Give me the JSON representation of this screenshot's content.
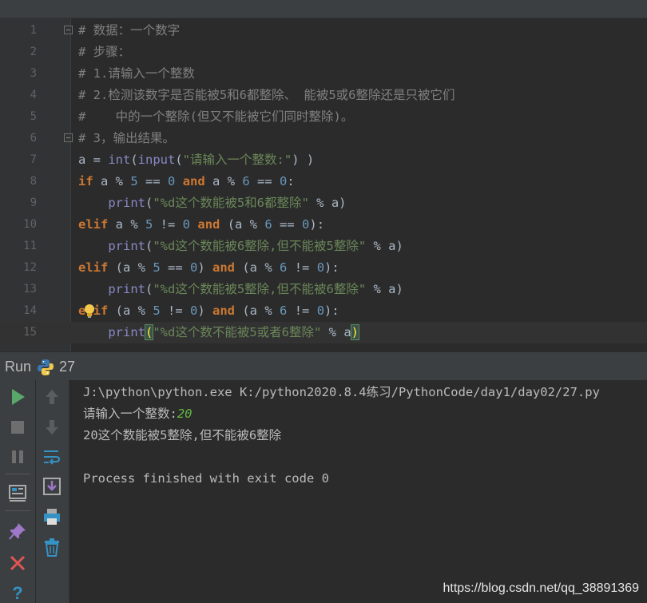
{
  "editor": {
    "lines": [
      {
        "num": "1",
        "parts": [
          {
            "c": "c",
            "t": "# 数据：一个数字"
          }
        ]
      },
      {
        "num": "2",
        "parts": [
          {
            "c": "c",
            "t": "# 步骤："
          }
        ]
      },
      {
        "num": "3",
        "parts": [
          {
            "c": "c",
            "t": "# 1.请输入一个整数"
          }
        ]
      },
      {
        "num": "4",
        "parts": [
          {
            "c": "c",
            "t": "# 2.检测该数字是否能被5和6都整除、 能被5或6整除还是只被它们"
          }
        ]
      },
      {
        "num": "5",
        "parts": [
          {
            "c": "c",
            "t": "#    中的一个整除(但又不能被它们同时整除)。"
          }
        ]
      },
      {
        "num": "6",
        "parts": [
          {
            "c": "c",
            "t": "# 3，输出结果。"
          }
        ]
      },
      {
        "num": "7",
        "parts": [
          {
            "c": "t",
            "t": "a = "
          },
          {
            "c": "b",
            "t": "int"
          },
          {
            "c": "t",
            "t": "("
          },
          {
            "c": "b",
            "t": "input"
          },
          {
            "c": "t",
            "t": "("
          },
          {
            "c": "s",
            "t": "\"请输入一个整数:\""
          },
          {
            "c": "t",
            "t": ") )"
          }
        ]
      },
      {
        "num": "8",
        "parts": [
          {
            "c": "k",
            "t": "if"
          },
          {
            "c": "t",
            "t": " a % "
          },
          {
            "c": "n",
            "t": "5"
          },
          {
            "c": "t",
            "t": " == "
          },
          {
            "c": "n",
            "t": "0"
          },
          {
            "c": "t",
            "t": " "
          },
          {
            "c": "k",
            "t": "and"
          },
          {
            "c": "t",
            "t": " a % "
          },
          {
            "c": "n",
            "t": "6"
          },
          {
            "c": "t",
            "t": " == "
          },
          {
            "c": "n",
            "t": "0"
          },
          {
            "c": "t",
            "t": ":"
          }
        ]
      },
      {
        "num": "9",
        "parts": [
          {
            "c": "t",
            "t": "    "
          },
          {
            "c": "b",
            "t": "print"
          },
          {
            "c": "t",
            "t": "("
          },
          {
            "c": "s",
            "t": "\"%d这个数能被5和6都整除\""
          },
          {
            "c": "t",
            "t": " % a)"
          }
        ]
      },
      {
        "num": "10",
        "parts": [
          {
            "c": "k",
            "t": "elif"
          },
          {
            "c": "t",
            "t": " a % "
          },
          {
            "c": "n",
            "t": "5"
          },
          {
            "c": "t",
            "t": " != "
          },
          {
            "c": "n",
            "t": "0"
          },
          {
            "c": "t",
            "t": " "
          },
          {
            "c": "k",
            "t": "and"
          },
          {
            "c": "t",
            "t": " (a % "
          },
          {
            "c": "n",
            "t": "6"
          },
          {
            "c": "t",
            "t": " == "
          },
          {
            "c": "n",
            "t": "0"
          },
          {
            "c": "t",
            "t": "):"
          }
        ]
      },
      {
        "num": "11",
        "parts": [
          {
            "c": "t",
            "t": "    "
          },
          {
            "c": "b",
            "t": "print"
          },
          {
            "c": "t",
            "t": "("
          },
          {
            "c": "s",
            "t": "\"%d这个数能被6整除,但不能被5整除\""
          },
          {
            "c": "t",
            "t": " % a)"
          }
        ]
      },
      {
        "num": "12",
        "parts": [
          {
            "c": "k",
            "t": "elif"
          },
          {
            "c": "t",
            "t": " (a % "
          },
          {
            "c": "n",
            "t": "5"
          },
          {
            "c": "t",
            "t": " == "
          },
          {
            "c": "n",
            "t": "0"
          },
          {
            "c": "t",
            "t": ") "
          },
          {
            "c": "k",
            "t": "and"
          },
          {
            "c": "t",
            "t": " (a % "
          },
          {
            "c": "n",
            "t": "6"
          },
          {
            "c": "t",
            "t": " != "
          },
          {
            "c": "n",
            "t": "0"
          },
          {
            "c": "t",
            "t": "):"
          }
        ]
      },
      {
        "num": "13",
        "parts": [
          {
            "c": "t",
            "t": "    "
          },
          {
            "c": "b",
            "t": "print"
          },
          {
            "c": "t",
            "t": "("
          },
          {
            "c": "s",
            "t": "\"%d这个数能被5整除,但不能被6整除\""
          },
          {
            "c": "t",
            "t": " % a)"
          }
        ]
      },
      {
        "num": "14",
        "parts": [
          {
            "c": "k",
            "t": "elif"
          },
          {
            "c": "t",
            "t": " (a % "
          },
          {
            "c": "n",
            "t": "5"
          },
          {
            "c": "t",
            "t": " != "
          },
          {
            "c": "n",
            "t": "0"
          },
          {
            "c": "t",
            "t": ") "
          },
          {
            "c": "k",
            "t": "and"
          },
          {
            "c": "t",
            "t": " (a % "
          },
          {
            "c": "n",
            "t": "6"
          },
          {
            "c": "t",
            "t": " != "
          },
          {
            "c": "n",
            "t": "0"
          },
          {
            "c": "t",
            "t": "):"
          }
        ]
      },
      {
        "num": "15",
        "parts": [
          {
            "c": "t",
            "t": "    "
          },
          {
            "c": "b",
            "t": "print"
          },
          {
            "c": "bracket",
            "t": "("
          },
          {
            "c": "s",
            "t": "\"%d这个数不能被5或者6整除\""
          },
          {
            "c": "t",
            "t": " % a"
          },
          {
            "c": "bracket",
            "t": ")"
          }
        ]
      }
    ]
  },
  "run": {
    "label": "Run",
    "config_name": "27"
  },
  "console": {
    "command": "J:\\python\\python.exe K:/python2020.8.4练习/PythonCode/day1/day02/27.py",
    "prompt": "请输入一个整数:",
    "user_input": "20",
    "output": "20这个数能被5整除,但不能被6整除",
    "exit_message": "Process finished with exit code 0"
  },
  "watermark": "https://blog.csdn.net/qq_38891369",
  "colors": {
    "comment": "#808080",
    "keyword": "#cc7832",
    "builtin": "#8888c6",
    "number": "#6897bb",
    "string": "#6a8759",
    "run_green": "#59a869",
    "stop_red": "#e05555"
  }
}
